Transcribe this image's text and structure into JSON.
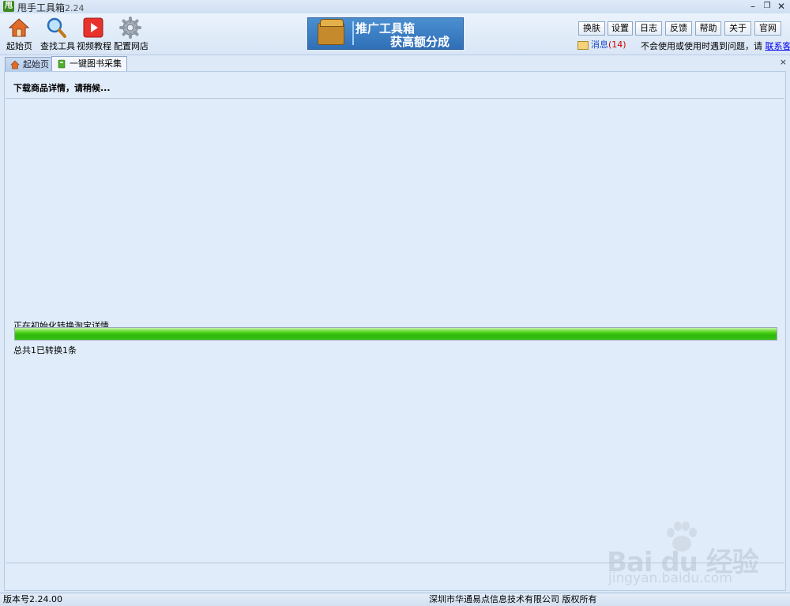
{
  "window": {
    "title": "甩手工具箱",
    "version": "2.24",
    "minimize_glyph": "–",
    "restore_glyph": "❐",
    "close_glyph": "✕"
  },
  "toolbar": {
    "items": [
      {
        "label": "起始页",
        "icon": "home-icon"
      },
      {
        "label": "查找工具",
        "icon": "magnifier-icon"
      },
      {
        "label": "视频教程",
        "icon": "video-play-icon"
      },
      {
        "label": "配置网店",
        "icon": "gear-icon"
      }
    ]
  },
  "banner": {
    "line1": "推广工具箱",
    "line2": "获高额分成"
  },
  "top_buttons": [
    "换肤",
    "设置",
    "日志",
    "反馈",
    "帮助",
    "关于",
    "官网"
  ],
  "messages": {
    "label": "消息",
    "count": "(14)"
  },
  "help_text": {
    "text": "不会使用或使用时遇到问题，请",
    "link": "联系客服"
  },
  "tabs": [
    {
      "label": "起始页",
      "icon": "home-icon",
      "active": false
    },
    {
      "label": "一键图书采集",
      "icon": "book-icon",
      "active": true
    }
  ],
  "tab_close_glyph": "×",
  "main": {
    "status": "下载商品详情，请稍候...",
    "progress_label": "正在初始化转换淘宝详情.....",
    "progress_percent": 100,
    "progress_color": "#37c213",
    "count_label": "总共1已转换1条"
  },
  "statusbar": {
    "version": "版本号2.24.00",
    "copyright": "深圳市华通易点信息技术有限公司 版权所有"
  },
  "watermark": {
    "brand": "Bai du 经验",
    "url": "jingyan.baidu.com"
  }
}
